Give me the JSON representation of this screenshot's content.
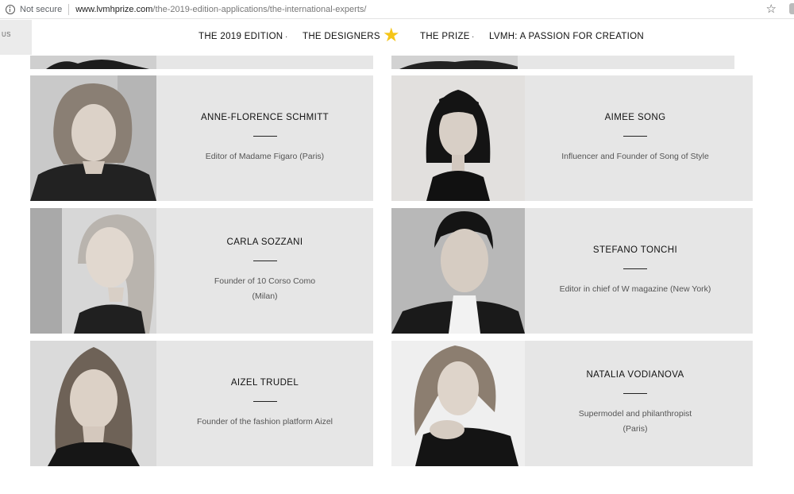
{
  "browser": {
    "security_label": "Not secure",
    "url_host": "www.lvmhprize.com",
    "url_path": "/the-2019-edition-applications/the-international-experts/"
  },
  "side_tab_label": "US",
  "nav": {
    "items": [
      "THE 2019 EDITION",
      "THE DESIGNERS",
      "THE PRIZE",
      "LVMH: A PASSION FOR CREATION"
    ],
    "separator": "·",
    "star_glyph": "★",
    "star_color": "#f5c518"
  },
  "experts": [
    {
      "name": "ANNE-FLORENCE SCHMITT",
      "lines": [
        "Editor of Madame Figaro (Paris)"
      ]
    },
    {
      "name": "AIMEE SONG",
      "lines": [
        "Influencer and Founder of Song of Style"
      ]
    },
    {
      "name": "CARLA SOZZANI",
      "lines": [
        "Founder of 10 Corso Como",
        "(Milan)"
      ]
    },
    {
      "name": "STEFANO TONCHI",
      "lines": [
        "Editor in chief of W magazine (New York)"
      ]
    },
    {
      "name": "AIZEL TRUDEL",
      "lines": [
        "Founder of the fashion platform Aizel"
      ]
    },
    {
      "name": "NATALIA VODIANOVA",
      "lines": [
        "Supermodel and philanthropist",
        "(Paris)"
      ]
    }
  ],
  "colors": {
    "card_bg": "#e6e6e6",
    "accent_star": "#f5c518"
  }
}
